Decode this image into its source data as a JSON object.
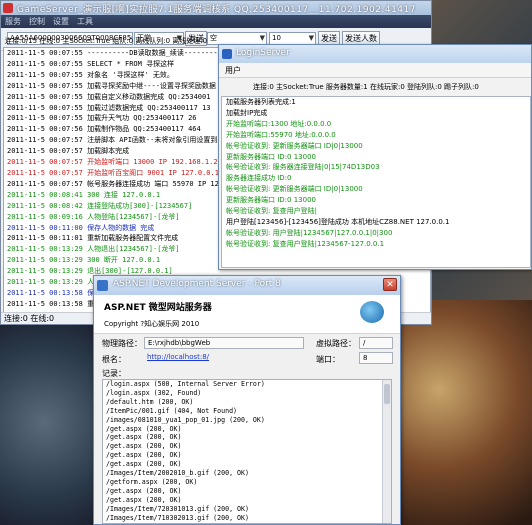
{
  "game_server": {
    "title": "GameServer_演示服[啊]实拉服7.1服务端调核系 QQ:253400117__11.702.1902.41417",
    "menu": [
      "服务",
      "控制",
      "设置",
      "工具"
    ],
    "toolbar": {
      "url_input": "AA55A6000003006609T0008CF85CDB3E",
      "mode_value": "正常",
      "send1_label": "发送",
      "channel_value": "空",
      "number_value": "10",
      "send2_label": "发送",
      "send_count_label": "发送人数"
    },
    "status": "连接:0/15  在线:0  主Socket:True  组队:0 离线队列:0 离线处理:0",
    "log": [
      {
        "text": "2011-11-5  00:07:55 ----------DB读取数据_续读----------",
        "c": ""
      },
      {
        "text": "2011-11-5  00:07:55 SELECT * FROM 寻探这样",
        "c": ""
      },
      {
        "text": "2011-11-5  00:07:55 对象名 '寻探这样' 无效。",
        "c": ""
      },
      {
        "text": "2011-11-5  00:07:55 加载寻探奖励中继----设置寻探奖励数据",
        "c": ""
      },
      {
        "text": "2011-11-5  00:07:55 加载自定义移动数据完成 QQ:2534001",
        "c": ""
      },
      {
        "text": "2011-11-5  00:07:55 加载过滤数据完成  QQ:253400117  13",
        "c": ""
      },
      {
        "text": "2011-11-5  00:07:55 加载升天气功 QQ:253400117   26",
        "c": ""
      },
      {
        "text": "2011-11-5  00:07:56 加载制作物品 QQ:253400117   464",
        "c": ""
      },
      {
        "text": "2011-11-5  00:07:57 注册脚本 API函数--未将对象引用设置到实例",
        "c": ""
      },
      {
        "text": "2011-11-5  00:07:57 加载脚本完成",
        "c": ""
      },
      {
        "text": "2011-11-5  00:07:57 开始监听端口  13000 IP 192.168.1.2",
        "c": "red"
      },
      {
        "text": "2011-11-5  00:07:57 开始监听百宝阁口  9001 IP 127.0.0.1",
        "c": "red"
      },
      {
        "text": "2011-11-5  00:07:57 帐号服务器连接成功  端口 55970 IP 127.0.0",
        "c": ""
      },
      {
        "text": "2011-11-5  00:08:41 300 连接 127.0.0.1",
        "c": "green"
      },
      {
        "text": "2011-11-5  00:08:42 连接登陆成功[300]-[1234567]",
        "c": "green"
      },
      {
        "text": "2011-11-5  00:09:16 人物登陆[1234567]-[龙爷]",
        "c": "green"
      },
      {
        "text": "2011-11-5  00:11:00 保存人物的数据  完成",
        "c": "blue"
      },
      {
        "text": "2011-11-5  00:11:01 重新加载服务器配置文件完成",
        "c": ""
      },
      {
        "text": "2011-11-5  00:13:29 人物退出[1234567]-[龙爷]",
        "c": "green"
      },
      {
        "text": "2011-11-5  00:13:29 300 断开 127.0.0.1",
        "c": "green"
      },
      {
        "text": "2011-11-5  00:13:29 退出[300]-[127.0.0.1]",
        "c": "green"
      },
      {
        "text": "2011-11-5  00:13:29 人物",
        "c": "green"
      },
      {
        "text": "2011-11-5  00:13:58 保存",
        "c": "blue"
      },
      {
        "text": "2011-11-5  00:13:58 重新",
        "c": ""
      }
    ],
    "footer": "连接:0 在线:0"
  },
  "login_server": {
    "title": "LoginServer",
    "menu": [
      "用户"
    ],
    "status": "连接:0 主Socket:True 服务器数量:1 在线玩家:0 登陆列队:0 踢子列队:0",
    "log": [
      {
        "text": "加载服务器列表完成:1",
        "c": ""
      },
      {
        "text": "加载封IP完成",
        "c": ""
      },
      {
        "text": "开始监听端口:1300 地址:0.0.0.0",
        "c": "green"
      },
      {
        "text": "开始监听端口:55970 地址:0.0.0.0",
        "c": "green"
      },
      {
        "text": "帐号验证收到: 更新服务器端口 ID|0|13000",
        "c": "green"
      },
      {
        "text": "更新服务器端口 ID:0     13000",
        "c": "green"
      },
      {
        "text": "帐号验证收到: 服务器连接登陆|0|15|74D13D03",
        "c": "green"
      },
      {
        "text": "服务器连接成功 ID:0",
        "c": "green"
      },
      {
        "text": "帐号验证收到: 更新服务器端口 ID|0|13000",
        "c": "green"
      },
      {
        "text": "更新服务器端口 ID:0     13000",
        "c": "green"
      },
      {
        "text": "帐号验证收到: 复查用户登陆|",
        "c": "green"
      },
      {
        "text": "用户登陆[123456]-[123456]登陆成功  本机地址CZ88.NET 127.0.0.1",
        "c": ""
      },
      {
        "text": "帐号验证收到: 用户登陆|1234567|127.0.0.1|0|300",
        "c": "green"
      },
      {
        "text": "帐号验证收到: 复查用户登陆|1234567-127.0.0.1",
        "c": "green"
      }
    ]
  },
  "aspnet_server": {
    "title": "ASP.NET Development Server - Port 8",
    "close_glyph": "✕",
    "header_title": "ASP.NET 微型网站服务器",
    "copyright": "Copyright ?知心娱乐网 2010",
    "physical_path_label": "物理路径：",
    "physical_path_value": "E:\\rxjhdb\\bbgWeb",
    "virtual_path_label": "虚拟路径：",
    "virtual_path_value": "/",
    "root_url_label": "根名：",
    "root_url_value": "http://localhost:8/",
    "port_label": "端口：",
    "port_value": "8",
    "log_label": "记录：",
    "log": [
      "/login.aspx (500, Internal Server Error)",
      "/login.aspx (302, Found)",
      "/default.htm (200, OK)",
      "/ItemPic/001.gif (404, Not Found)",
      "/images/081010_yua1_pop_01.jpg (200, OK)",
      "/get.aspx (200, OK)",
      "/get.aspx (200, OK)",
      "/get.aspx (200, OK)",
      "/get.aspx (200, OK)",
      "/get.aspx (200, OK)",
      "/Images/Item/2002010_b.gif (200, OK)",
      "/getform.aspx (200, OK)",
      "/get.aspx (200, OK)",
      "/get.aspx (200, OK)",
      "/Images/Item/720301013.gif (200, OK)",
      "/Images/Item/710302013.gif (200, OK)",
      "/Images/Item/710301013.gif (200, OK)",
      "/Images/Item/520302013.gif (200, OK)",
      "/Images/Item/520301013.gif (200, OK)"
    ]
  }
}
